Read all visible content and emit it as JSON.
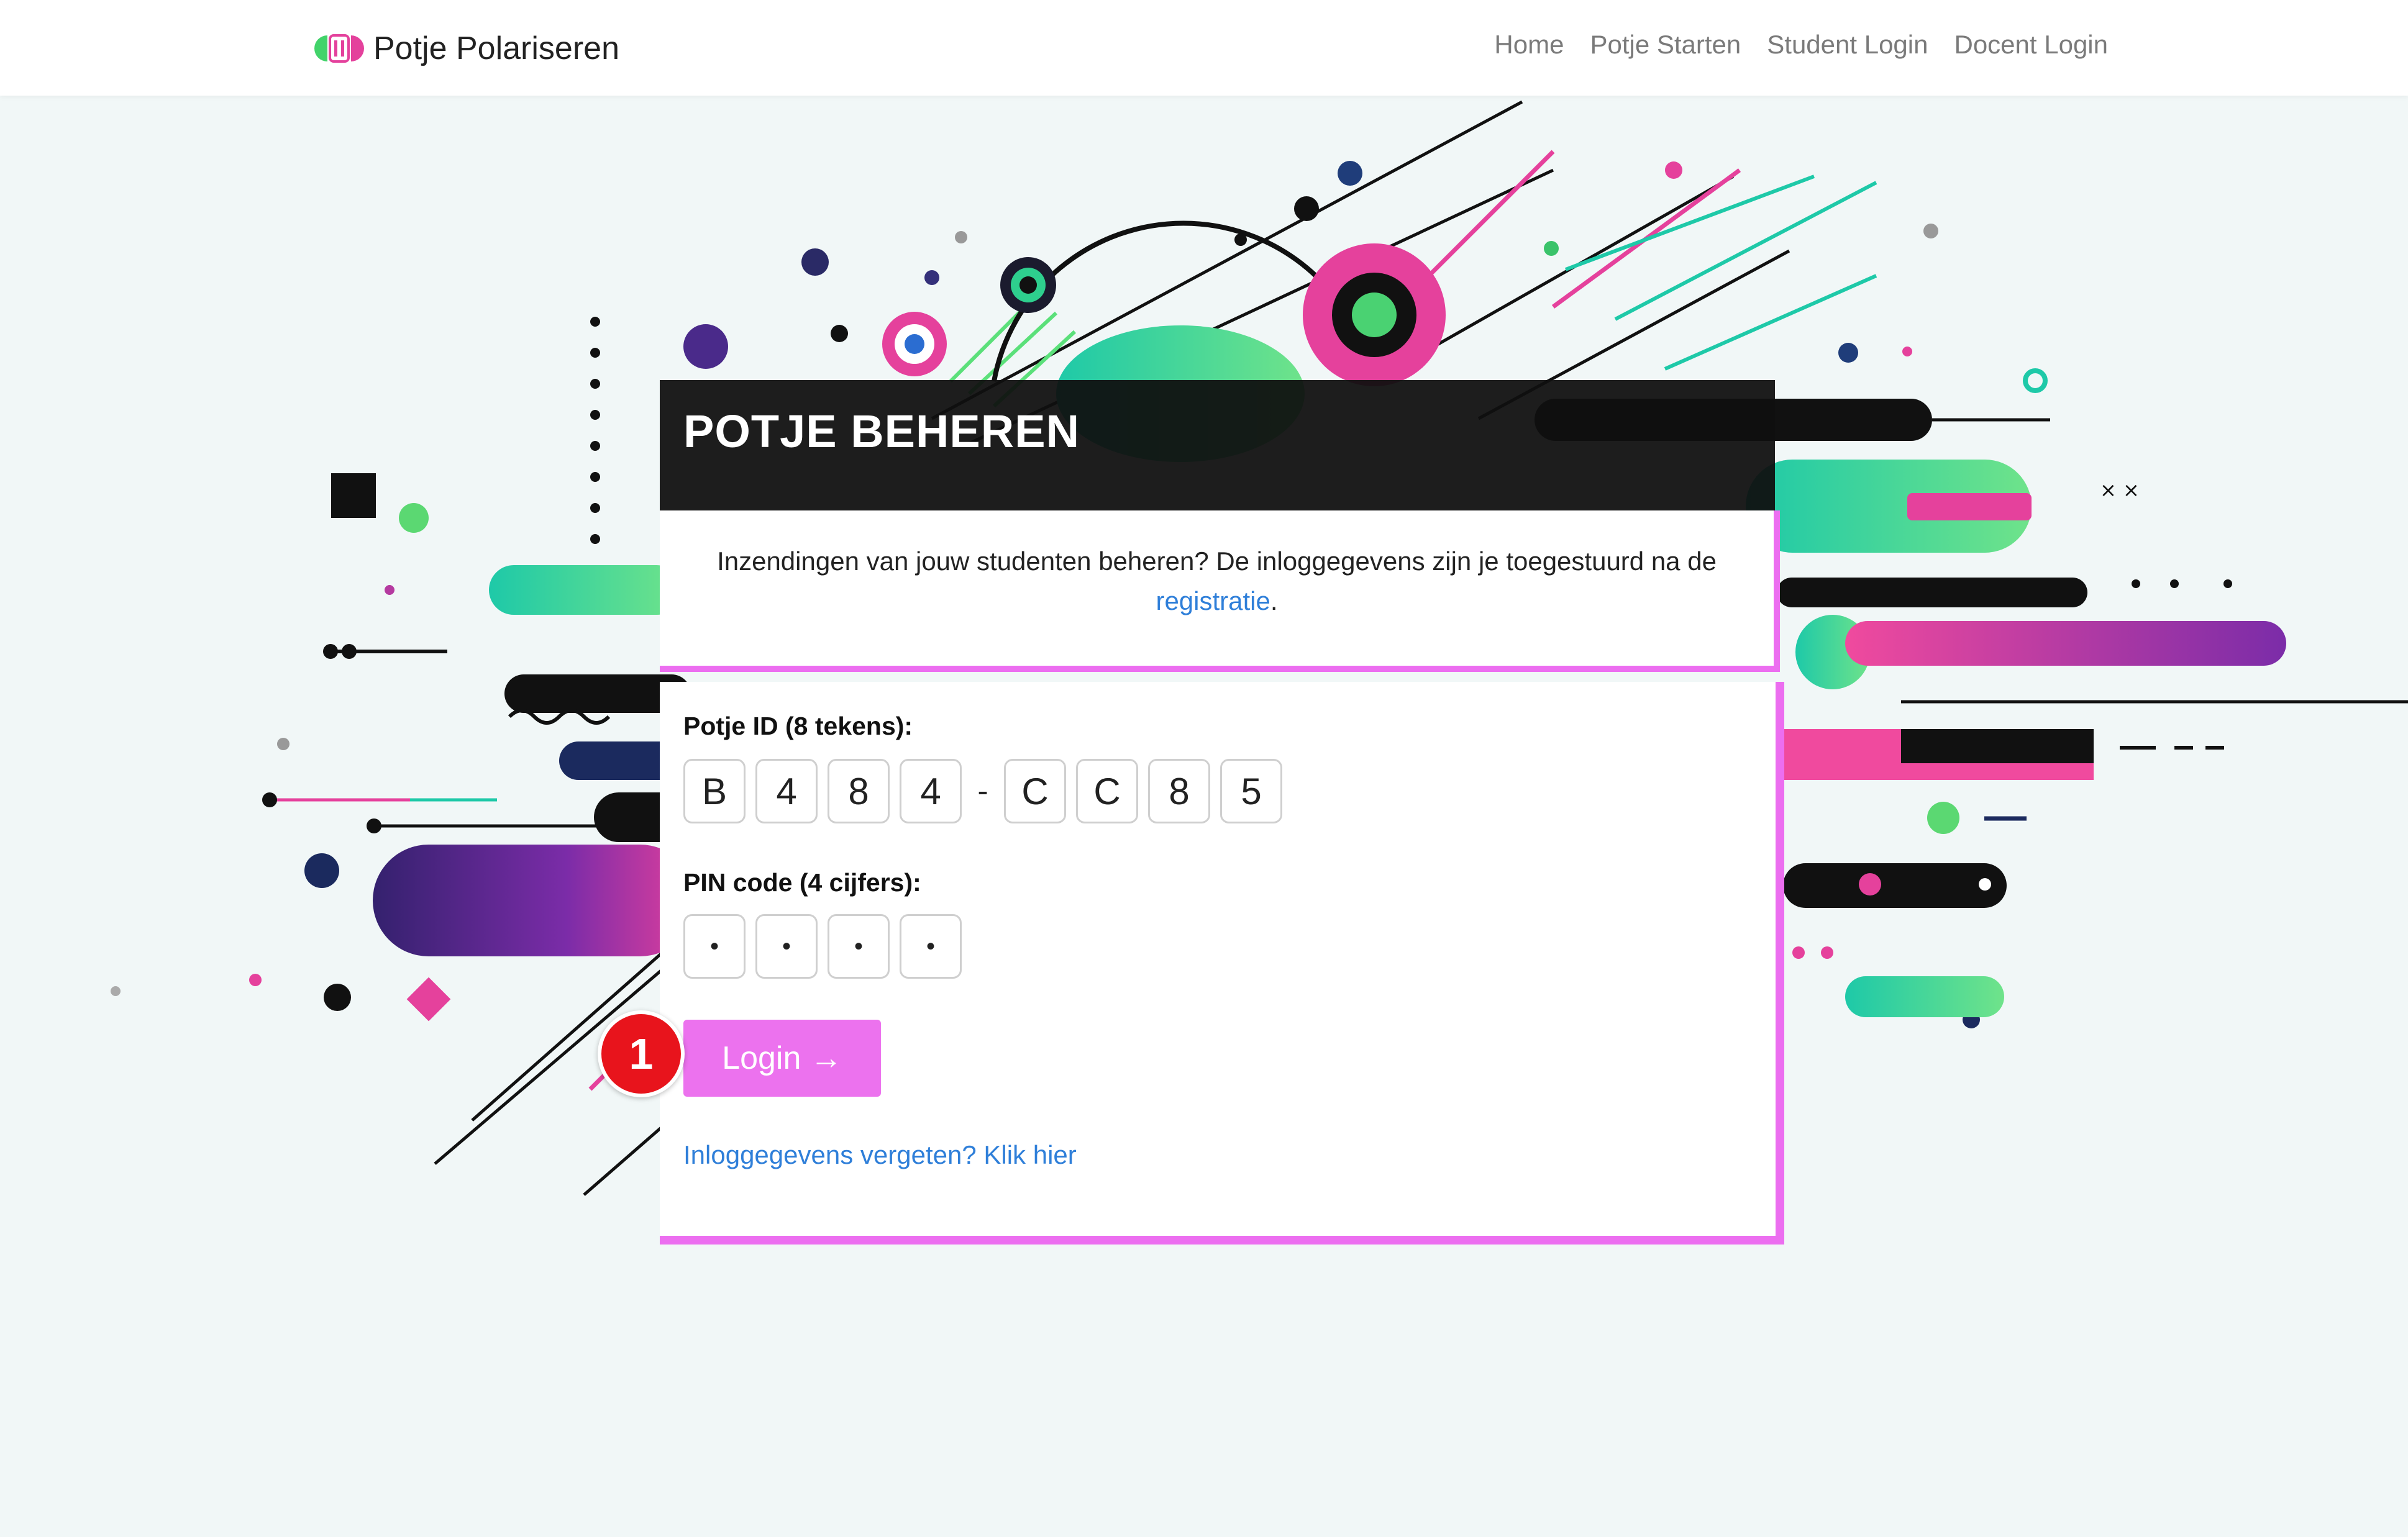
{
  "brand": {
    "name": "Potje Polariseren"
  },
  "nav": {
    "links": [
      "Home",
      "Potje Starten",
      "Student Login",
      "Docent Login"
    ]
  },
  "card": {
    "title": "POTJE BEHEREN",
    "intro_text": "Inzendingen van jouw studenten beheren? De inloggegevens zijn je toegestuurd na de",
    "intro_link": "registratie",
    "intro_end": "."
  },
  "form": {
    "potje_id_label": "Potje ID (8 tekens):",
    "potje_id_chars": [
      "B",
      "4",
      "8",
      "4",
      "C",
      "C",
      "8",
      "5"
    ],
    "separator": "-",
    "pin_label": "PIN code (4 cijfers):",
    "pin_chars": [
      "•",
      "•",
      "•",
      "•"
    ],
    "login_label": "Login →",
    "forgot_link": "Inloggegevens vergeten? Klik hier"
  },
  "annotation": {
    "step_number": "1"
  },
  "colors": {
    "accent": "#ec72ee",
    "header_bg": "#0f0f0f",
    "link": "#2f7fd9",
    "badge": "#e8141c"
  }
}
